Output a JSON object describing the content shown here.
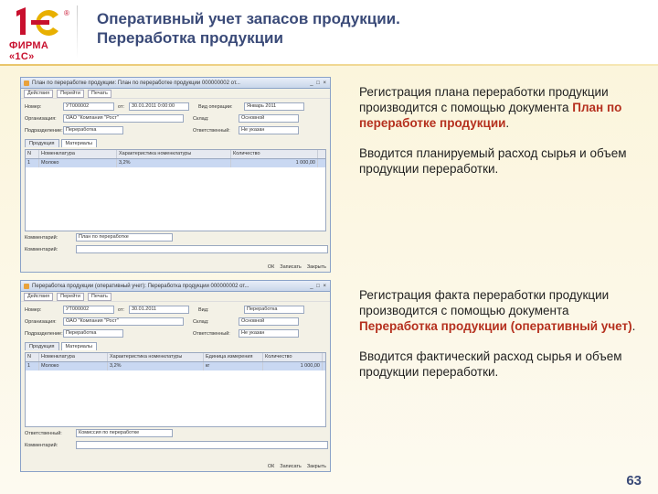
{
  "header": {
    "title_line1": "Оперативный учет запасов продукции.",
    "title_line2": "Переработка продукции",
    "logo_text": "ФИРМА «1С»",
    "logo_mark": "1С",
    "reg_mark": "®"
  },
  "window1": {
    "title": "План по переработке продукции: План по переработке продукции 000000002 от...",
    "controls": "_ □ ×",
    "toolbar": [
      "Действия",
      "Перейти",
      "Печать"
    ],
    "fields": {
      "number_label": "Номер:",
      "number_value": "УТ000002",
      "from_label": "от:",
      "from_value": "30.01.2011 0:00:00",
      "kind_label": "Вид операции:",
      "kind_value": "Январь 2011",
      "org_label": "Организация:",
      "org_value": "ОАО \"Компания \"Рост\"",
      "warehouse_label": "Склад:",
      "warehouse_value": "Основной",
      "sub_label": "Подразделение:",
      "sub_value": "Переработка",
      "resp_label": "Ответственный:",
      "resp_value": "Не указан"
    },
    "tabs": [
      "Продукция",
      "Материалы"
    ],
    "grid": {
      "columns": [
        "N",
        "Номенклатура",
        "Характеристика номенклатуры",
        "Количество"
      ],
      "rows": [
        [
          "1",
          "Молоко",
          "3,2%",
          "1 000,00"
        ]
      ]
    },
    "comment_label": "Комментарий:",
    "comment_value": "План по переработке",
    "footer": [
      "ОК",
      "Записать",
      "Закрыть"
    ]
  },
  "window2": {
    "title": "Переработка продукции (оперативный учет): Переработка продукции 000000002 от...",
    "controls": "_ □ ×",
    "toolbar": [
      "Действия",
      "Перейти",
      "Печать"
    ],
    "fields": {
      "number_label": "Номер:",
      "number_value": "УТ000002",
      "from_label": "от:",
      "from_value": "30.01.2011",
      "kind_label": "Вид:",
      "kind_value": "Переработка",
      "org_label": "Организация:",
      "org_value": "ОАО \"Компания \"Рост\"",
      "warehouse_label": "Склад:",
      "warehouse_value": "Основной",
      "sub_label": "Подразделение:",
      "sub_value": "Переработка",
      "resp_label": "Ответственный:",
      "resp_value": "Не указан"
    },
    "tabs": [
      "Продукция",
      "Материалы"
    ],
    "grid": {
      "columns": [
        "N",
        "Номенклатура",
        "Характеристика номенклатуры",
        "Единица измерения",
        "Количество"
      ],
      "rows": [
        [
          "1",
          "Молоко",
          "3,2%",
          "кг",
          "1 000,00"
        ]
      ]
    },
    "comment_label": "Ответственный:",
    "comment_value": "Комиссия по переработке",
    "comment2_label": "Комментарий:",
    "footer": [
      "ОК",
      "Записать",
      "Закрыть"
    ]
  },
  "text1": {
    "p1_start": "Регистрация плана переработки продукции производится с помощью документа ",
    "p1_highlight": "План по переработке продукции",
    "p1_end": ".",
    "p2": "Вводится планируемый расход сырья и объем продукции переработки."
  },
  "text2": {
    "p1_start": "Регистрация факта переработки продукции производится с помощью документа ",
    "p1_highlight": "Переработка продукции (оперативный учет)",
    "p1_end": ".",
    "p2": "Вводится фактический расход сырья и объем продукции переработки."
  },
  "page_number": "63",
  "colors": {
    "accent": "#c8102e",
    "title": "#3a4a78",
    "highlight": "#b5301e"
  }
}
